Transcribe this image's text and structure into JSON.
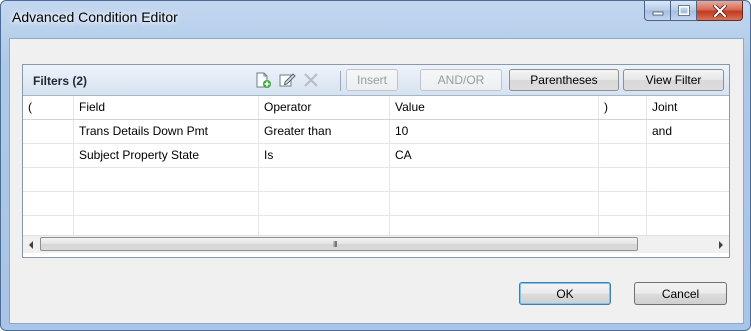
{
  "window": {
    "title": "Advanced Condition Editor",
    "caption_buttons": [
      "minimize-icon",
      "maximize-icon",
      "close-icon"
    ]
  },
  "filters_panel": {
    "title": "Filters (2)",
    "tool_icons": [
      "new-filter-icon",
      "edit-filter-icon",
      "delete-filter-icon"
    ],
    "buttons": {
      "insert": "Insert",
      "and_or": "AND/OR",
      "parentheses": "Parentheses",
      "view_filter": "View Filter"
    }
  },
  "grid": {
    "columns": [
      "(",
      "Field",
      "Operator",
      "Value",
      ")",
      "Joint"
    ],
    "rows": [
      [
        "",
        "Trans Details Down Pmt",
        "Greater than",
        "10",
        "",
        "and"
      ],
      [
        "",
        "Subject Property State",
        "Is",
        "CA",
        "",
        ""
      ],
      [
        "",
        "",
        "",
        "",
        "",
        ""
      ],
      [
        "",
        "",
        "",
        "",
        "",
        ""
      ],
      [
        "",
        "",
        "",
        "",
        "",
        ""
      ]
    ],
    "scroll_grip": "III"
  },
  "footer": {
    "ok": "OK",
    "cancel": "Cancel"
  }
}
